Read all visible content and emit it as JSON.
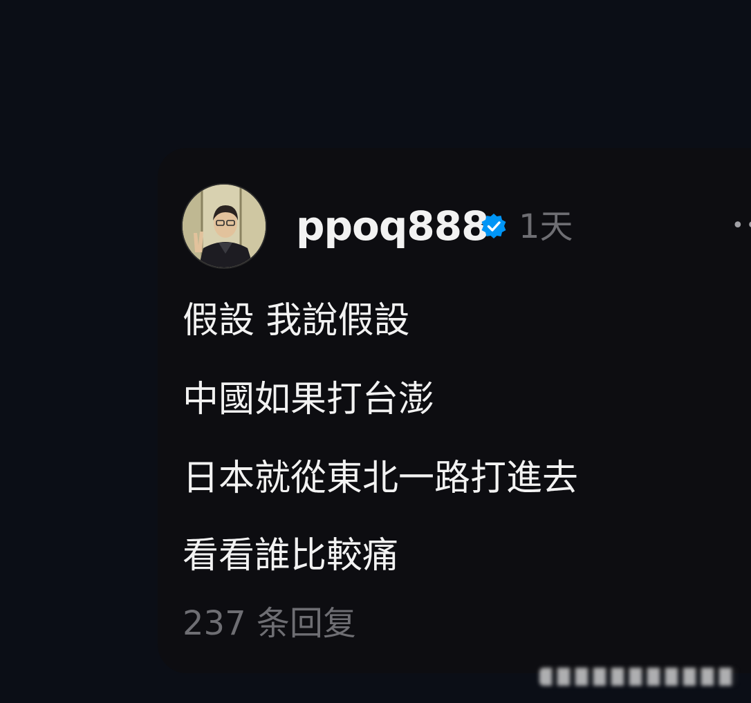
{
  "post": {
    "author": {
      "username": "ppoq888",
      "verified": true
    },
    "timestamp": "1天",
    "lines": [
      "假設 我說假設",
      "中國如果打台澎",
      "日本就從東北一路打進去",
      "看看誰比較痛"
    ],
    "reply_count_label": "237 条回复"
  },
  "icons": {
    "verified": "verified-badge-icon",
    "more": "more-options-icon"
  },
  "colors": {
    "background": "#0b0e16",
    "card": "#0d0d11",
    "text_primary": "#f2f2f2",
    "text_secondary": "#6e6e73",
    "verified_blue": "#0095f6"
  }
}
